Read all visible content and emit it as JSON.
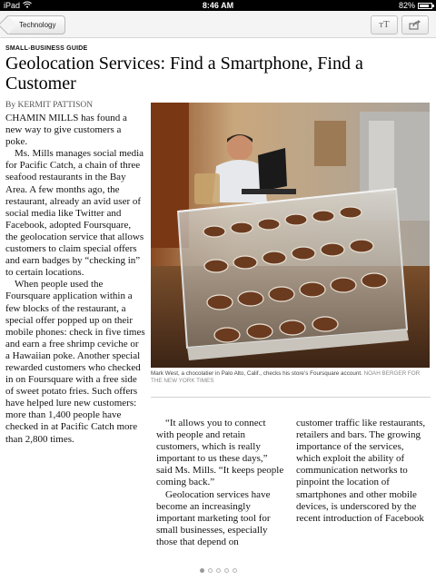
{
  "status_bar": {
    "device": "iPad",
    "time": "8:46 AM",
    "battery_text": "82%",
    "battery_level": 0.82
  },
  "toolbar": {
    "back_label": "Technology",
    "font_size_label": "ᴛT",
    "share_icon": "share-icon"
  },
  "article": {
    "kicker": "SMALL-BUSINESS GUIDE",
    "headline": "Geolocation Services: Find a Smartphone, Find a Customer",
    "byline": "By KERMIT PATTISON",
    "column1": [
      "CHAMIN MILLS has found a new way to give customers a poke.",
      "Ms. Mills manages social media for Pacific Catch, a chain of three seafood restaurants in the Bay Area. A few months ago, the restaurant, already an avid user of social media like Twitter and Facebook, adopted Foursquare, the geolocation service that allows customers to claim special offers and earn badges by “checking in” to certain locations.",
      "When people used the Foursquare application within a few blocks of the restaurant, a special offer popped up on their mobile phones: check in five times and earn a free shrimp ceviche or a Hawaiian poke. Another special rewarded customers who checked in on Foursquare with a free side of sweet potato fries. Such offers have helped lure new customers: more than 1,400 people have checked in at Pacific Catch more than 2,800 times."
    ],
    "column2": [
      "“It allows you to connect with people and retain customers, which is really important to us these days,” said Ms. Mills. “It keeps people coming back.”",
      "Geolocation services have become an increasingly important marketing tool for small businesses, especially those that depend on"
    ],
    "column3": [
      "customer traffic like restaurants, retailers and bars. The growing importance of the services, which exploit the ability of communication networks to pinpoint the location of smartphones and other mobile devices, is underscored by the recent introduction of Facebook"
    ],
    "photo": {
      "caption": "Mark West, a chocolatier in Palo Alto, Calif., checks his store’s Foursquare account.",
      "credit": "NOAH BERGER FOR THE NEW YORK TIMES"
    }
  },
  "pagination": {
    "total_pages": 5,
    "current_page": 1
  }
}
